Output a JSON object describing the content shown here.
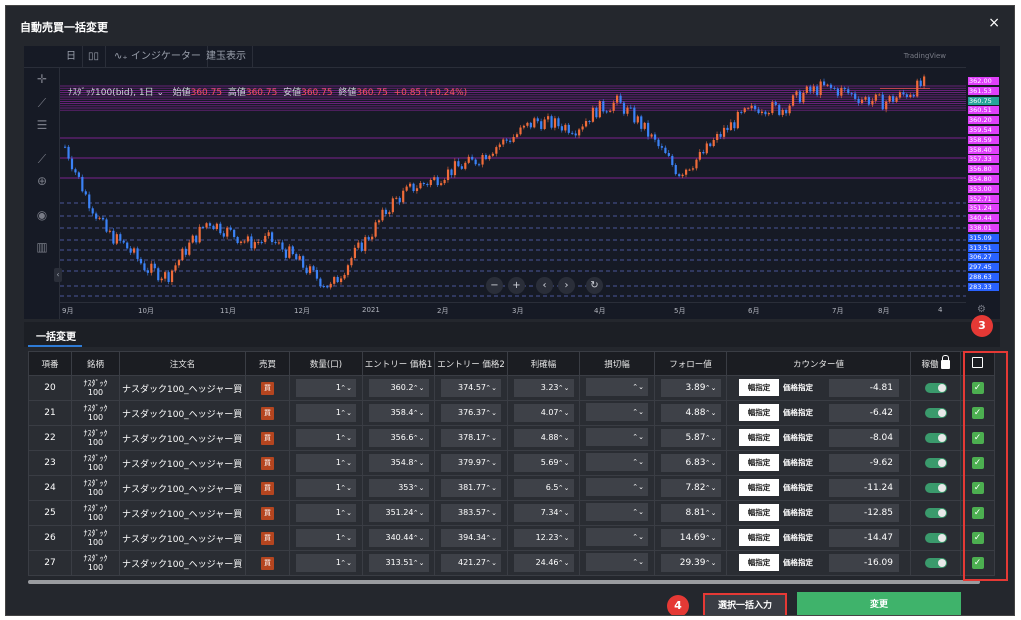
{
  "modal": {
    "title": "自動売買一括変更",
    "close": "×"
  },
  "chart_toolbar": {
    "interval": "日",
    "chart_type_icon": "candles-icon",
    "indicator": "インジケーター",
    "positions": "建玉表示",
    "brand": "TradingView"
  },
  "legend": {
    "symbol": "ﾅｽﾀﾞｯｸ100(bid), 1日",
    "open_label": "始値",
    "open": "360.75",
    "high_label": "高値",
    "high": "360.75",
    "low_label": "安値",
    "low": "360.75",
    "close_label": "終値",
    "close": "360.75",
    "change": "+0.85 (+0.24%)"
  },
  "chart_data": {
    "type": "candlestick",
    "x_ticks": [
      "9月",
      "10月",
      "11月",
      "12月",
      "2021",
      "2月",
      "3月",
      "4月",
      "5月",
      "6月",
      "7月",
      "8月",
      "4"
    ],
    "y_ticks": [
      "362.00",
      "361.53",
      "360.75",
      "360.51",
      "360.20",
      "359.54",
      "358.59",
      "358.40",
      "357.33",
      "356.80",
      "354.80",
      "353.00",
      "352.71",
      "351.24",
      "340.44",
      "338.01",
      "315.09",
      "313.51",
      "306.27",
      "297.45",
      "288.63",
      "283.33"
    ],
    "current_price": "360.75",
    "closes": [
      345,
      332,
      322,
      318,
      312,
      310,
      318,
      325,
      322,
      319,
      320,
      316,
      311,
      307,
      315,
      322,
      330,
      334,
      336,
      339,
      341,
      345,
      348,
      352,
      351,
      350,
      355,
      357,
      352,
      345,
      338,
      342,
      348,
      353,
      356,
      355,
      359,
      361,
      360,
      358,
      357,
      359,
      362
    ]
  },
  "nav": {
    "zoom_out": "−",
    "zoom_in": "+",
    "back": "‹",
    "forward": "›",
    "reset": "↻"
  },
  "bulk_tab": {
    "label": "一括変更"
  },
  "table": {
    "headers": {
      "index": "項番",
      "symbol": "銘柄",
      "order_name": "注文名",
      "side": "売買",
      "quantity": "数量(口)",
      "entry1": "エントリー 価格1",
      "entry2": "エントリー 価格2",
      "profit": "利確幅",
      "stop": "損切幅",
      "follow": "フォロー値",
      "counter": "カウンター値",
      "active": "稼働"
    },
    "rows": [
      {
        "index": "20",
        "symbol_top": "ﾅｽﾀﾞｯｸ",
        "symbol_bottom": "100",
        "order_name": "ナスダック100_ヘッジャー買",
        "side": "買",
        "qty": "1",
        "entry1": "360.2",
        "entry2": "374.57",
        "profit": "3.23",
        "stop": "",
        "follow": "3.89",
        "btn_range": "幅指定",
        "btn_price": "価格指定",
        "counter": "-4.81"
      },
      {
        "index": "21",
        "symbol_top": "ﾅｽﾀﾞｯｸ",
        "symbol_bottom": "100",
        "order_name": "ナスダック100_ヘッジャー買",
        "side": "買",
        "qty": "1",
        "entry1": "358.4",
        "entry2": "376.37",
        "profit": "4.07",
        "stop": "",
        "follow": "4.88",
        "btn_range": "幅指定",
        "btn_price": "価格指定",
        "counter": "-6.42"
      },
      {
        "index": "22",
        "symbol_top": "ﾅｽﾀﾞｯｸ",
        "symbol_bottom": "100",
        "order_name": "ナスダック100_ヘッジャー買",
        "side": "買",
        "qty": "1",
        "entry1": "356.6",
        "entry2": "378.17",
        "profit": "4.88",
        "stop": "",
        "follow": "5.87",
        "btn_range": "幅指定",
        "btn_price": "価格指定",
        "counter": "-8.04"
      },
      {
        "index": "23",
        "symbol_top": "ﾅｽﾀﾞｯｸ",
        "symbol_bottom": "100",
        "order_name": "ナスダック100_ヘッジャー買",
        "side": "買",
        "qty": "1",
        "entry1": "354.8",
        "entry2": "379.97",
        "profit": "5.69",
        "stop": "",
        "follow": "6.83",
        "btn_range": "幅指定",
        "btn_price": "価格指定",
        "counter": "-9.62"
      },
      {
        "index": "24",
        "symbol_top": "ﾅｽﾀﾞｯｸ",
        "symbol_bottom": "100",
        "order_name": "ナスダック100_ヘッジャー買",
        "side": "買",
        "qty": "1",
        "entry1": "353",
        "entry2": "381.77",
        "profit": "6.5",
        "stop": "",
        "follow": "7.82",
        "btn_range": "幅指定",
        "btn_price": "価格指定",
        "counter": "-11.24"
      },
      {
        "index": "25",
        "symbol_top": "ﾅｽﾀﾞｯｸ",
        "symbol_bottom": "100",
        "order_name": "ナスダック100_ヘッジャー買",
        "side": "買",
        "qty": "1",
        "entry1": "351.24",
        "entry2": "383.57",
        "profit": "7.34",
        "stop": "",
        "follow": "8.81",
        "btn_range": "幅指定",
        "btn_price": "価格指定",
        "counter": "-12.85"
      },
      {
        "index": "26",
        "symbol_top": "ﾅｽﾀﾞｯｸ",
        "symbol_bottom": "100",
        "order_name": "ナスダック100_ヘッジャー買",
        "side": "買",
        "qty": "1",
        "entry1": "340.44",
        "entry2": "394.34",
        "profit": "12.23",
        "stop": "",
        "follow": "14.69",
        "btn_range": "幅指定",
        "btn_price": "価格指定",
        "counter": "-14.47"
      },
      {
        "index": "27",
        "symbol_top": "ﾅｽﾀﾞｯｸ",
        "symbol_bottom": "100",
        "order_name": "ナスダック100_ヘッジャー買",
        "side": "買",
        "qty": "1",
        "entry1": "313.51",
        "entry2": "421.27",
        "profit": "24.46",
        "stop": "",
        "follow": "29.39",
        "btn_range": "幅指定",
        "btn_price": "価格指定",
        "counter": "-16.09"
      }
    ]
  },
  "badges": {
    "b3": "3",
    "b4": "4"
  },
  "buttons": {
    "bulk_input": "選択一括入力",
    "change": "変更"
  },
  "colors": {
    "buy": "#b5451f",
    "change_btn": "#3fb36b",
    "highlight": "#e53935",
    "up": "#ef6c3a",
    "down": "#3b82f6"
  }
}
